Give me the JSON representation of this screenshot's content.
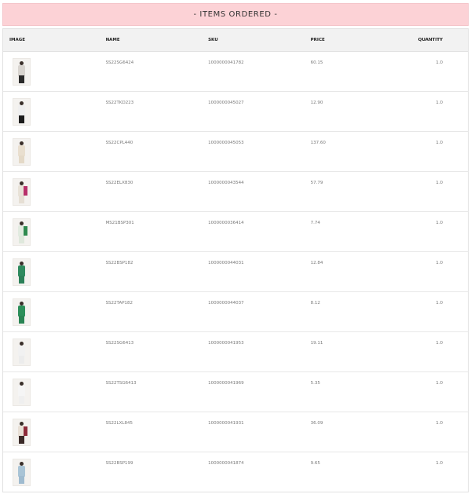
{
  "banner": {
    "title": "- ITEMS ORDERED -"
  },
  "table": {
    "headers": {
      "image": "IMAGE",
      "name": "NAME",
      "sku": "SKU",
      "price": "PRICE",
      "quantity": "QUANTITY"
    },
    "rows": [
      {
        "image_alt": "product-photo",
        "name": "SS22SG6424",
        "sku": "1000000041782",
        "price": "60.15",
        "quantity": "1.0",
        "colors": {
          "body": "#d8d4cf",
          "legs": "#2a2a2a",
          "acc": ""
        }
      },
      {
        "image_alt": "product-photo",
        "name": "SS22TKD223",
        "sku": "1000000045027",
        "price": "12.90",
        "quantity": "1.0",
        "colors": {
          "body": "#efefef",
          "legs": "#1c1c1c",
          "acc": ""
        }
      },
      {
        "image_alt": "product-photo",
        "name": "SS22CPL440",
        "sku": "1000000045053",
        "price": "137.60",
        "quantity": "1.0",
        "colors": {
          "body": "#e9dfcf",
          "legs": "#e4d9c7",
          "acc": ""
        }
      },
      {
        "image_alt": "product-photo",
        "name": "SS22ELX830",
        "sku": "1000000043544",
        "price": "57.79",
        "quantity": "1.0",
        "colors": {
          "body": "#e8e2d8",
          "legs": "#e6dfd4",
          "acc": "#b8306a"
        }
      },
      {
        "image_alt": "product-photo",
        "name": "MS21BSP301",
        "sku": "1000000036414",
        "price": "7.74",
        "quantity": "1.0",
        "colors": {
          "body": "#e2ebe0",
          "legs": "#dfe8dc",
          "acc": "#2f8a4f"
        }
      },
      {
        "image_alt": "product-photo",
        "name": "SS22BSP182",
        "sku": "1000000044031",
        "price": "12.84",
        "quantity": "1.0",
        "colors": {
          "body": "#2f8a5e",
          "legs": "#2c8058",
          "acc": ""
        }
      },
      {
        "image_alt": "product-photo",
        "name": "SS22TAP182",
        "sku": "1000000044037",
        "price": "8.12",
        "quantity": "1.0",
        "colors": {
          "body": "#2d8f5a",
          "legs": "#2a8453",
          "acc": ""
        }
      },
      {
        "image_alt": "product-photo",
        "name": "SS22SG6413",
        "sku": "1000000041953",
        "price": "19.11",
        "quantity": "1.0",
        "colors": {
          "body": "#f1f1f1",
          "legs": "#ececec",
          "acc": ""
        }
      },
      {
        "image_alt": "product-photo",
        "name": "SS22TSG6413",
        "sku": "1000000041969",
        "price": "5.35",
        "quantity": "1.0",
        "colors": {
          "body": "#f5f5f5",
          "legs": "#efefef",
          "acc": ""
        }
      },
      {
        "image_alt": "product-photo",
        "name": "SS22LXL845",
        "sku": "1000000041931",
        "price": "36.09",
        "quantity": "1.0",
        "colors": {
          "body": "#e8e0d6",
          "legs": "#3a2a28",
          "acc": "#8e2b3a"
        }
      },
      {
        "image_alt": "product-photo",
        "name": "SS22BSP199",
        "sku": "1000000041874",
        "price": "9.65",
        "quantity": "1.0",
        "colors": {
          "body": "#a9c4d6",
          "legs": "#9fbbcf",
          "acc": ""
        }
      }
    ]
  }
}
